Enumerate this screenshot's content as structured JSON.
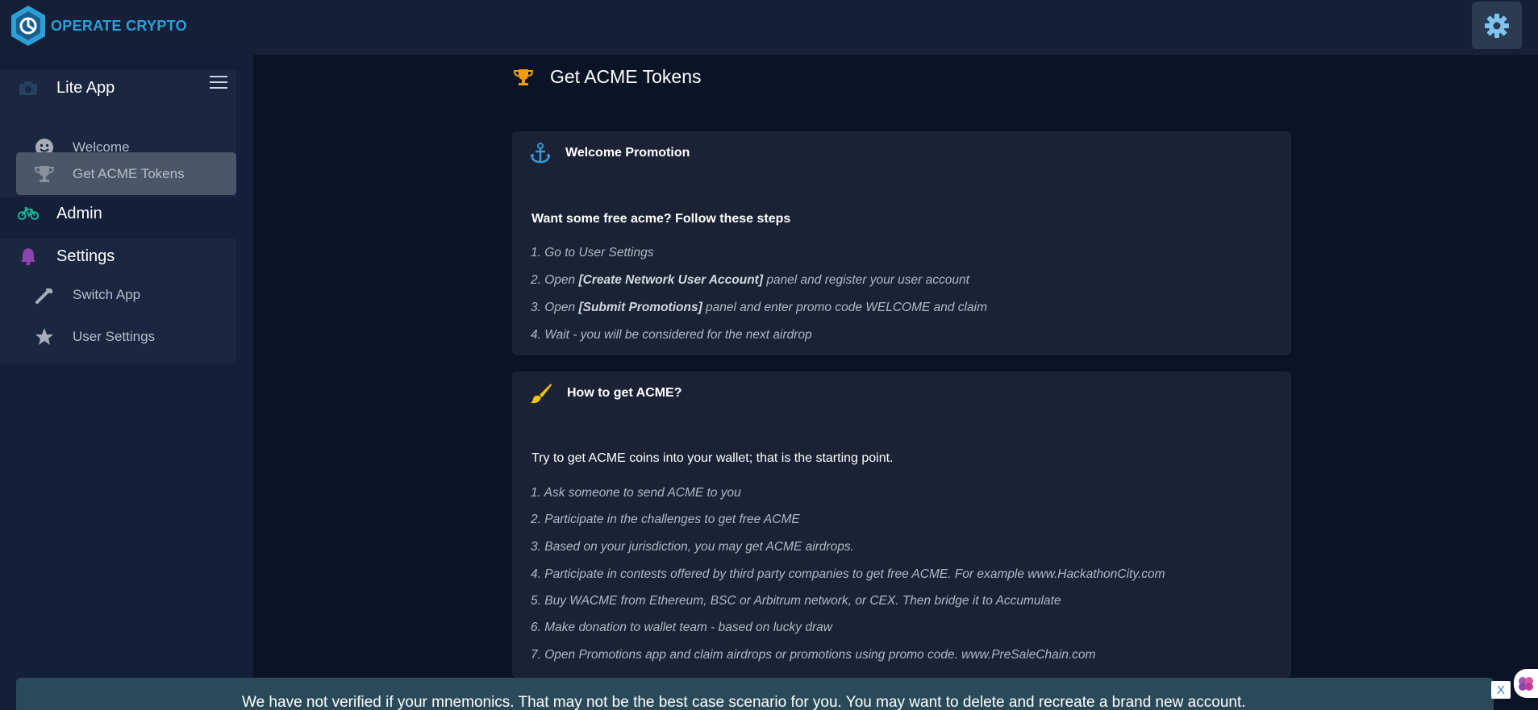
{
  "app": {
    "logo_text": "OPERATE CRYPTO"
  },
  "header": {
    "settings_icon": "gear-icon"
  },
  "sidebar": {
    "lite_app": {
      "label": "Lite App",
      "icon": "camera-icon",
      "items": [
        {
          "label": "Welcome",
          "icon": "smile-icon"
        },
        {
          "label": "Get ACME Tokens",
          "icon": "trophy-icon",
          "active": true
        }
      ]
    },
    "admin": {
      "label": "Admin",
      "icon": "bicycle-icon"
    },
    "settings": {
      "label": "Settings",
      "icon": "bell-icon",
      "items": [
        {
          "label": "Switch App",
          "icon": "wrench-icon"
        },
        {
          "label": "User Settings",
          "icon": "star-icon"
        }
      ]
    }
  },
  "page": {
    "title": "Get ACME Tokens",
    "icon": "trophy-icon"
  },
  "cards": [
    {
      "title": "Welcome Promotion",
      "icon": "anchor-icon",
      "intro": "Want some free acme? Follow these steps",
      "steps": [
        {
          "pre": "1. Go to User Settings"
        },
        {
          "pre": "2. Open ",
          "bold": "[Create Network User Account]",
          "post": " panel and register your user account"
        },
        {
          "pre": "3. Open ",
          "bold": "[Submit Promotions]",
          "post": " panel and enter promo code WELCOME and claim"
        },
        {
          "pre": "4. Wait - you will be considered for the next airdrop"
        }
      ]
    },
    {
      "title": "How to get ACME?",
      "icon": "paint-brush-icon",
      "intro": "Try to get ACME coins into your wallet; that is the starting point.",
      "steps": [
        "1. Ask someone to send ACME to you",
        "2. Participate in the challenges to get free ACME",
        "3. Based on your jurisdiction, you may get ACME airdrops.",
        "4. Participate in contests offered by third party companies to get free ACME. For example www.HackathonCity.com",
        "5. Buy WACME from Ethereum, BSC or Arbitrum network, or CEX. Then bridge it to Accumulate",
        "6. Make donation to wallet team - based on lucky draw",
        "7. Open Promotions app and claim airdrops or promotions using promo code. www.PreSaleChain.com"
      ]
    }
  ],
  "banner": {
    "text": "We have not verified if your mnemonics. That may not be the best case scenario for you. You may want to delete and recreate a brand new account.",
    "close_label": "X"
  },
  "colors": {
    "background": "#0b1426",
    "sidebar": "#142039",
    "accent_blue": "#2d9fd6",
    "trophy": "#f39c12",
    "admin_icon": "#1abc9c",
    "bell_icon": "#8e44ad"
  }
}
